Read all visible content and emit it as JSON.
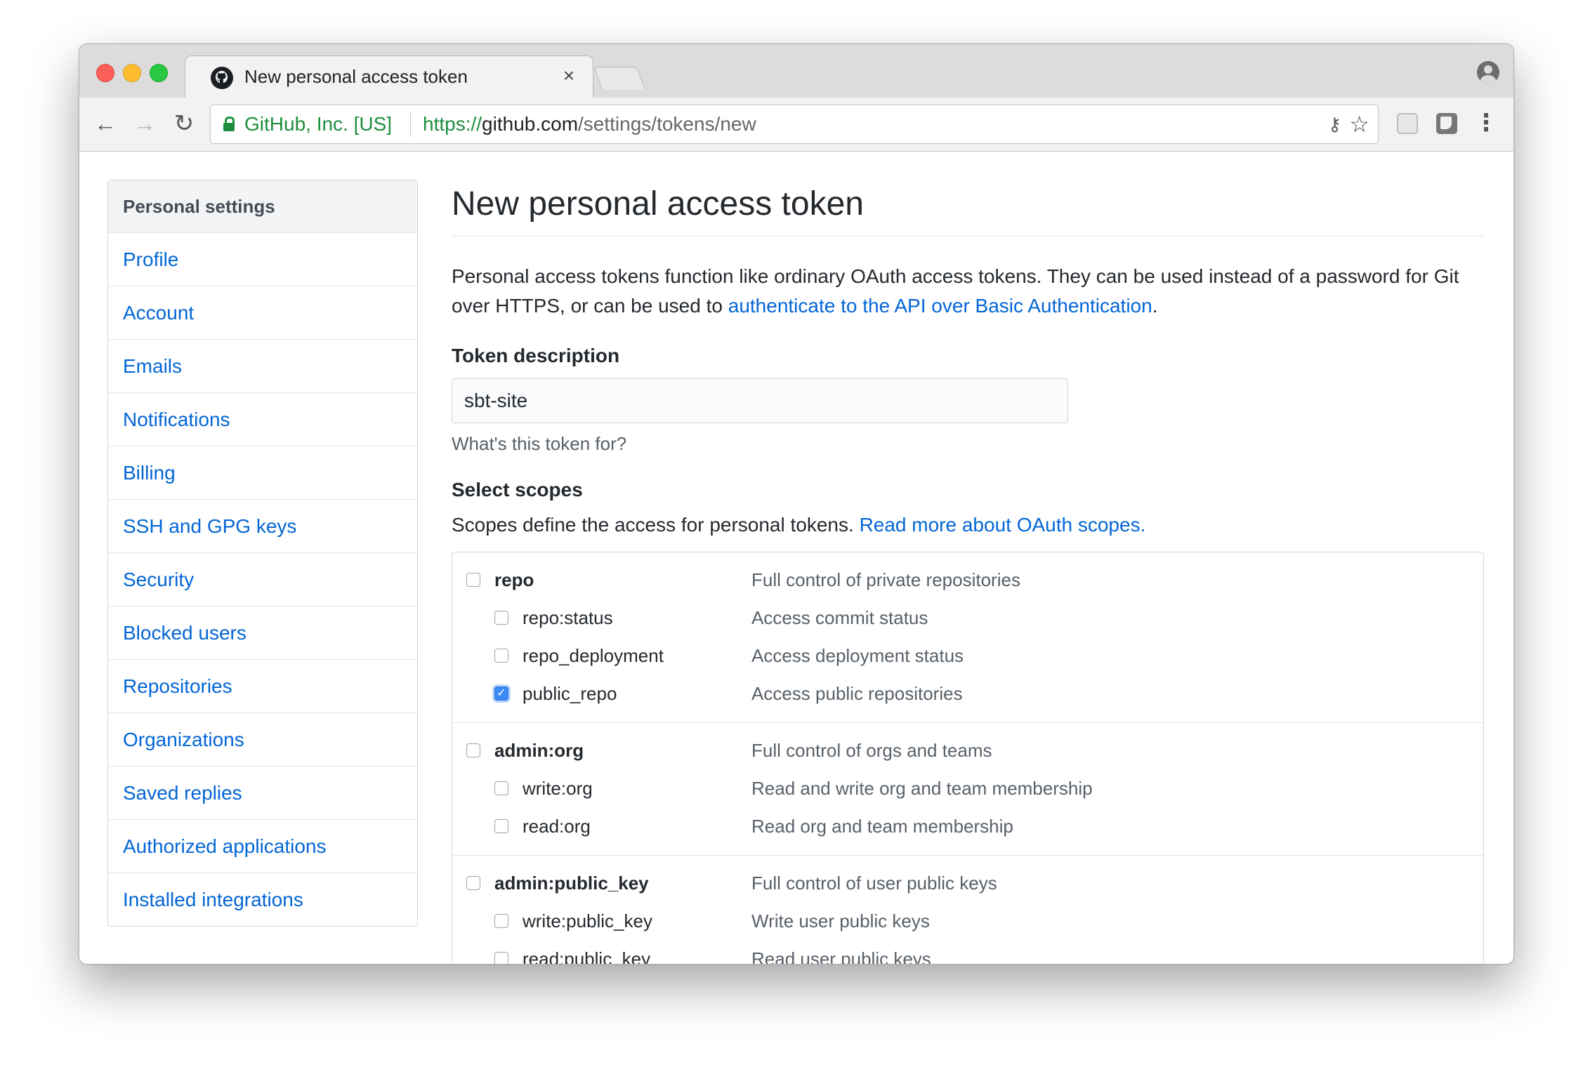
{
  "browser": {
    "tab_title": "New personal access token",
    "tab_close": "×",
    "org": "GitHub, Inc. [US]",
    "url_scheme": "https://",
    "url_host": "github.com",
    "url_path": "/settings/tokens/new",
    "icons": [
      "github-favicon",
      "back-icon",
      "forward-icon",
      "reload-icon",
      "lock-icon",
      "key-icon",
      "star-icon",
      "extension-icon",
      "menu-icon",
      "profile-icon"
    ]
  },
  "sidebar": {
    "header": "Personal settings",
    "items": [
      {
        "label": "Profile"
      },
      {
        "label": "Account"
      },
      {
        "label": "Emails"
      },
      {
        "label": "Notifications"
      },
      {
        "label": "Billing"
      },
      {
        "label": "SSH and GPG keys"
      },
      {
        "label": "Security"
      },
      {
        "label": "Blocked users"
      },
      {
        "label": "Repositories"
      },
      {
        "label": "Organizations"
      },
      {
        "label": "Saved replies"
      },
      {
        "label": "Authorized applications"
      },
      {
        "label": "Installed integrations"
      }
    ]
  },
  "main": {
    "title": "New personal access token",
    "intro_text": "Personal access tokens function like ordinary OAuth access tokens. They can be used instead of a password for Git over HTTPS, or can be used to ",
    "intro_link": "authenticate to the API over Basic Authentication",
    "intro_end": ".",
    "token_label": "Token description",
    "token_value": "sbt-site",
    "token_note": "What's this token for?",
    "scopes_label": "Select scopes",
    "scopes_text": "Scopes define the access for personal tokens. ",
    "scopes_link": "Read more about OAuth scopes.",
    "checkbox_colors": {
      "checked": "#3b8bf7",
      "unchecked_border": "#9ea4aa"
    },
    "scope_groups": [
      {
        "name": "repo",
        "desc": "Full control of private repositories",
        "checked": false,
        "children": [
          {
            "name": "repo:status",
            "desc": "Access commit status",
            "checked": false
          },
          {
            "name": "repo_deployment",
            "desc": "Access deployment status",
            "checked": false
          },
          {
            "name": "public_repo",
            "desc": "Access public repositories",
            "checked": true
          }
        ]
      },
      {
        "name": "admin:org",
        "desc": "Full control of orgs and teams",
        "checked": false,
        "children": [
          {
            "name": "write:org",
            "desc": "Read and write org and team membership",
            "checked": false
          },
          {
            "name": "read:org",
            "desc": "Read org and team membership",
            "checked": false
          }
        ]
      },
      {
        "name": "admin:public_key",
        "desc": "Full control of user public keys",
        "checked": false,
        "children": [
          {
            "name": "write:public_key",
            "desc": "Write user public keys",
            "checked": false
          },
          {
            "name": "read:public_key",
            "desc": "Read user public keys",
            "checked": false
          }
        ]
      }
    ]
  }
}
